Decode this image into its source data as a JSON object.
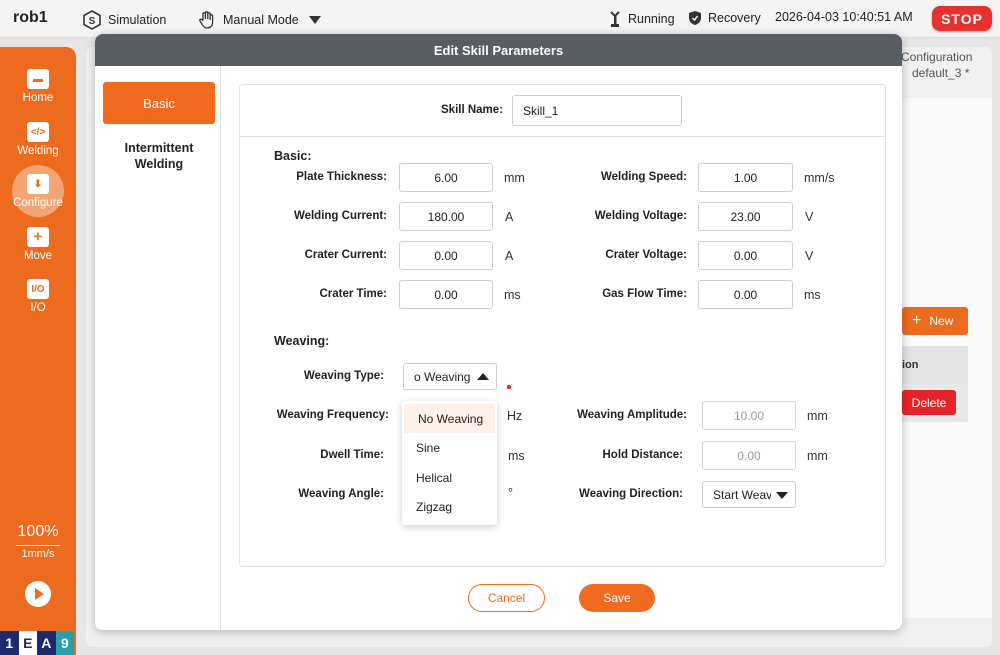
{
  "topbar": {
    "robot_name": "rob1",
    "mode": "Simulation",
    "control": "Manual Mode",
    "status": "Running",
    "recovery": "Recovery",
    "datetime": "2026-04-03 10:40:51 AM",
    "stop_label": "STOP"
  },
  "sidebar": {
    "items": [
      {
        "label": "Home",
        "icon": "home-icon"
      },
      {
        "label": "Welding",
        "icon": "code-icon"
      },
      {
        "label": "Configure",
        "icon": "configure-icon"
      },
      {
        "label": "Move",
        "icon": "move-icon"
      },
      {
        "label": "I/O",
        "icon": "io-icon"
      }
    ],
    "active": "Configure",
    "speed_percent": "100%",
    "speed_value": "1mm/s",
    "logo_letters": [
      "1",
      "E",
      "A",
      "9"
    ],
    "logo_colors": [
      "#1e2a6e",
      "#ffffff",
      "#1e2a6e",
      "#2aa1a8"
    ]
  },
  "background": {
    "config_label": "Configuration",
    "config_value": "default_3 *",
    "new_label": "New",
    "col_header": "ion",
    "delete_label": "Delete"
  },
  "modal": {
    "title": "Edit Skill Parameters",
    "tabs": {
      "basic": "Basic",
      "intermittent": "Intermittent Welding"
    },
    "skill_name_label": "Skill Name:",
    "skill_name_value": "Skill_1",
    "basic_section": "Basic:",
    "weaving_section": "Weaving:",
    "fields": {
      "plate_thickness": {
        "label": "Plate Thickness:",
        "value": "6.00",
        "unit": "mm"
      },
      "welding_speed": {
        "label": "Welding Speed:",
        "value": "1.00",
        "unit": "mm/s"
      },
      "welding_current": {
        "label": "Welding Current:",
        "value": "180.00",
        "unit": "A"
      },
      "welding_voltage": {
        "label": "Welding Voltage:",
        "value": "23.00",
        "unit": "V"
      },
      "crater_current": {
        "label": "Crater Current:",
        "value": "0.00",
        "unit": "A"
      },
      "crater_voltage": {
        "label": "Crater Voltage:",
        "value": "0.00",
        "unit": "V"
      },
      "crater_time": {
        "label": "Crater Time:",
        "value": "0.00",
        "unit": "ms"
      },
      "gas_flow_time": {
        "label": "Gas Flow Time:",
        "value": "0.00",
        "unit": "ms"
      },
      "weaving_type": {
        "label": "Weaving Type:",
        "value": "o Weaving"
      },
      "weaving_frequency": {
        "label": "Weaving Frequency:",
        "unit": "Hz"
      },
      "weaving_amplitude": {
        "label": "Weaving Amplitude:",
        "value": "10.00",
        "unit": "mm"
      },
      "dwell_time": {
        "label": "Dwell Time:",
        "unit": "ms"
      },
      "hold_distance": {
        "label": "Hold Distance:",
        "value": "0.00",
        "unit": "mm"
      },
      "weaving_angle": {
        "label": "Weaving Angle:",
        "unit": "°"
      },
      "weaving_direction": {
        "label": "Weaving Direction:",
        "value": "Start Weav"
      }
    },
    "weaving_options": [
      "No Weaving",
      "Sine",
      "Helical",
      "Zigzag"
    ],
    "cancel_label": "Cancel",
    "save_label": "Save"
  }
}
